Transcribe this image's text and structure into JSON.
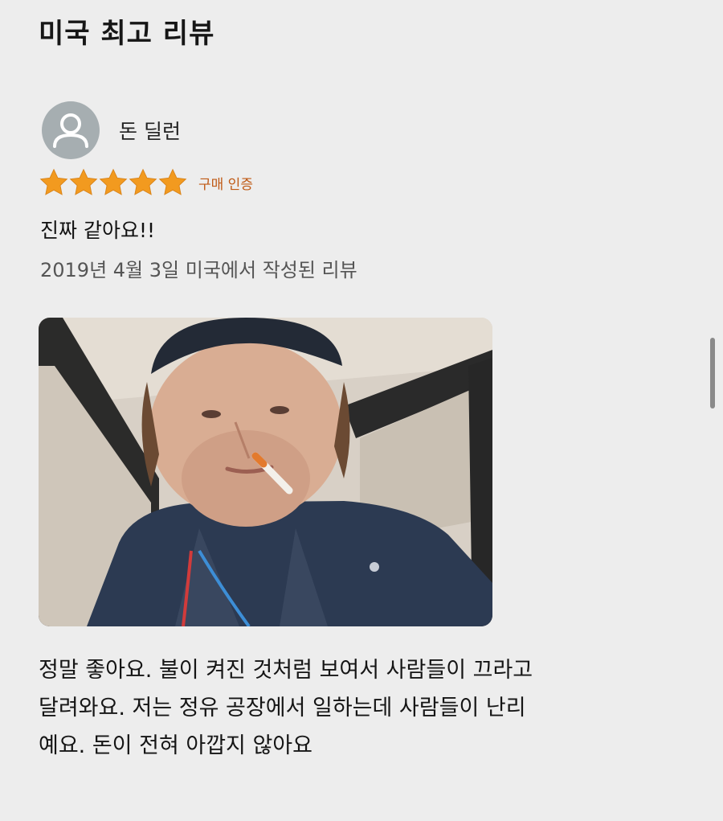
{
  "section": {
    "title": "미국 최고 리뷰"
  },
  "review": {
    "reviewer_name": "돈 딜런",
    "avatar_icon": "person-avatar-icon",
    "rating": 5,
    "rating_max": 5,
    "star_color": "#f29a1f",
    "verified_label": "구매 인증",
    "verified_color": "#c05a16",
    "title": "진짜 같아요!!",
    "meta": "2019년 4월 3일 미국에서 작성된 리뷰",
    "body_lines": [
      "정말 좋아요. 불이 켜진 것처럼 보여서 사람들이 끄라고",
      "달려와요. 저는 정유 공장에서 일하는데 사람들이 난리",
      "예요. 돈이 전혀 아깝지 않아요"
    ]
  }
}
